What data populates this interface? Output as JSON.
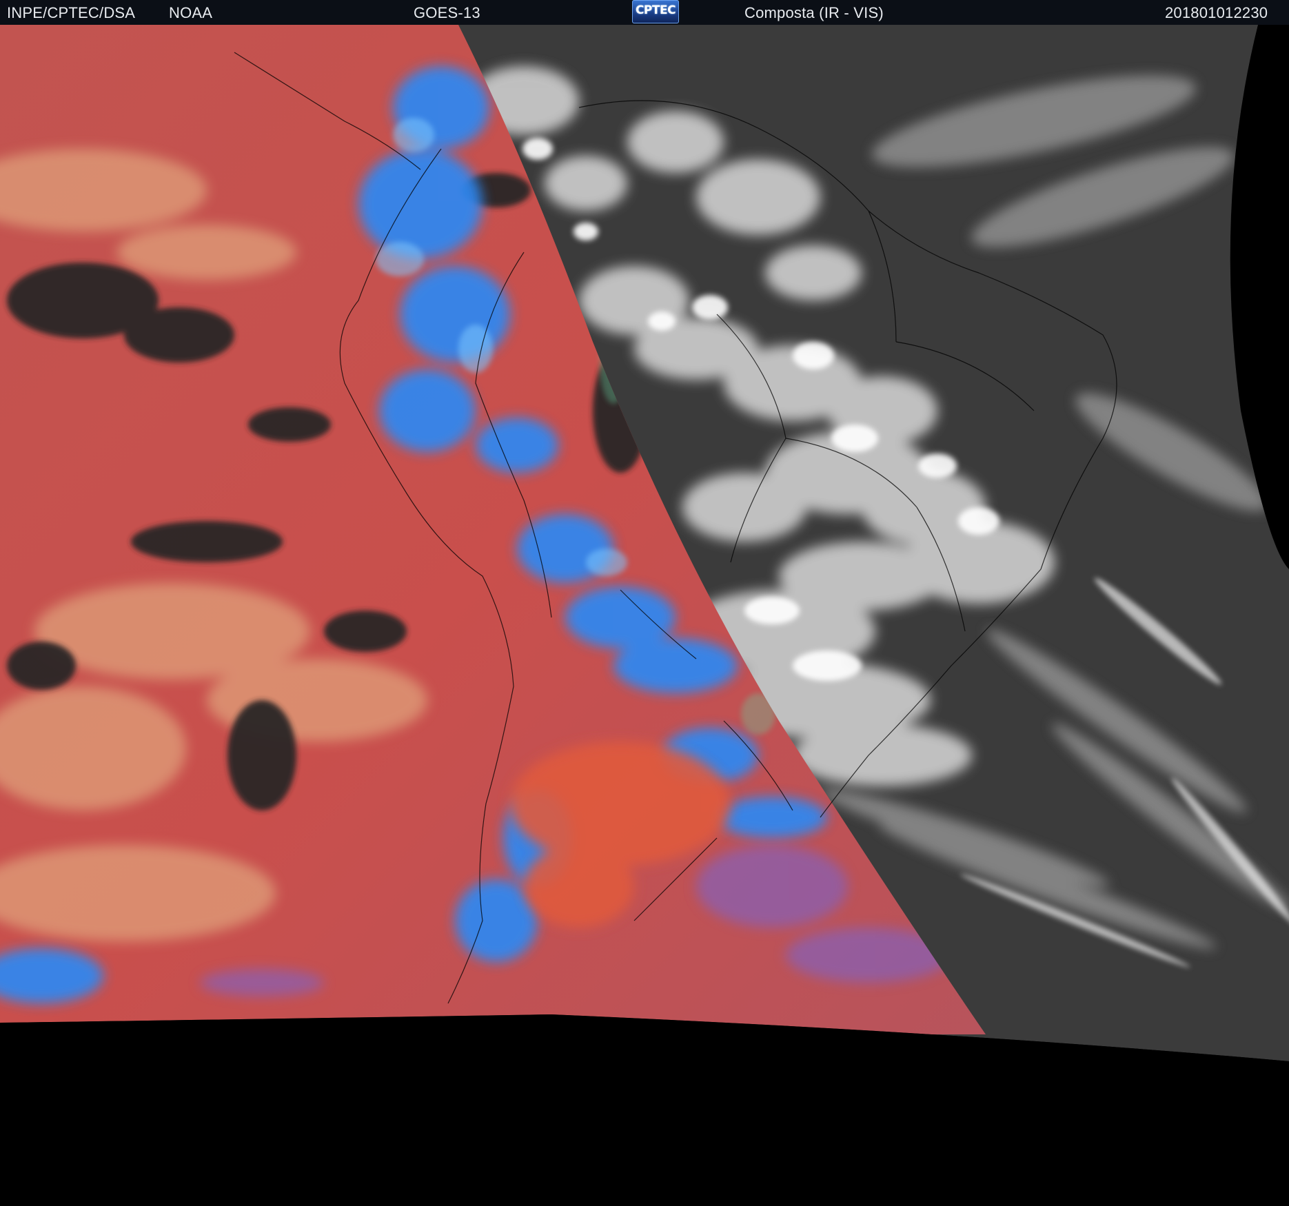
{
  "header": {
    "source": "INPE/CPTEC/DSA",
    "agency": "NOAA",
    "satellite": "GOES-13",
    "logo_text": "CPTEC",
    "product": "Composta (IR - VIS)",
    "timestamp": "201801012230"
  },
  "map": {
    "colors": {
      "header_bg": "#0b0f16",
      "header_text": "#e8ebef",
      "ir_red": "#c9504f",
      "ir_cold_blue": "#2f86f0",
      "ir_clear": "#2a2626",
      "vis_background": "#3d3d3d",
      "vis_cloud": "#e6e6e6",
      "space": "#000000",
      "borders": "#000000"
    },
    "icons": [
      "cptec-logo-icon"
    ]
  }
}
